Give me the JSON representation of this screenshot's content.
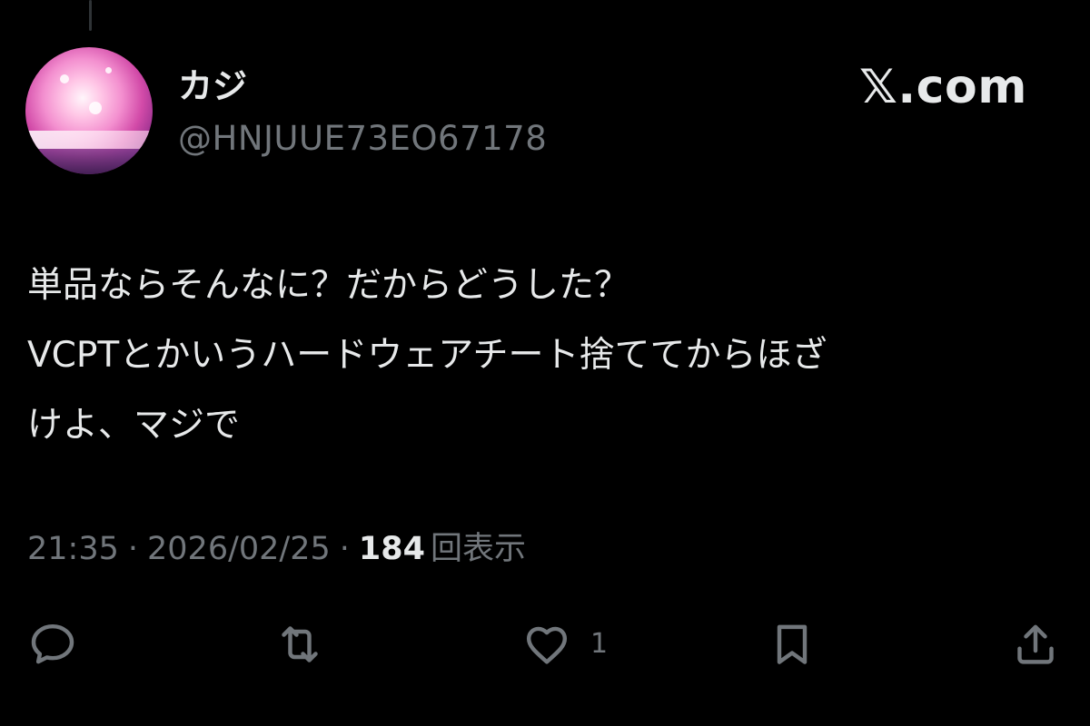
{
  "tweet": {
    "display_name": "カジ",
    "handle": "@HNJUUE73EO67178",
    "brand": "𝕏.com",
    "text_lines": [
      "単品ならそんなに？だからどうした？",
      "VCPTとかいうハードウェアチート捨ててからほざ",
      "けよ、マジで"
    ],
    "time": "21:35",
    "separator": "·",
    "date": "2026/02/25",
    "views_count": "184",
    "views_label": "回表示"
  },
  "actions": {
    "reply": {
      "icon": "reply-icon"
    },
    "retweet": {
      "icon": "retweet-icon"
    },
    "like": {
      "icon": "heart-icon",
      "count": "1"
    },
    "bookmark": {
      "icon": "bookmark-icon"
    },
    "share": {
      "icon": "share-icon"
    }
  },
  "colors": {
    "background": "#000000",
    "primary_text": "#e7e9ea",
    "secondary_text": "#71767b"
  }
}
